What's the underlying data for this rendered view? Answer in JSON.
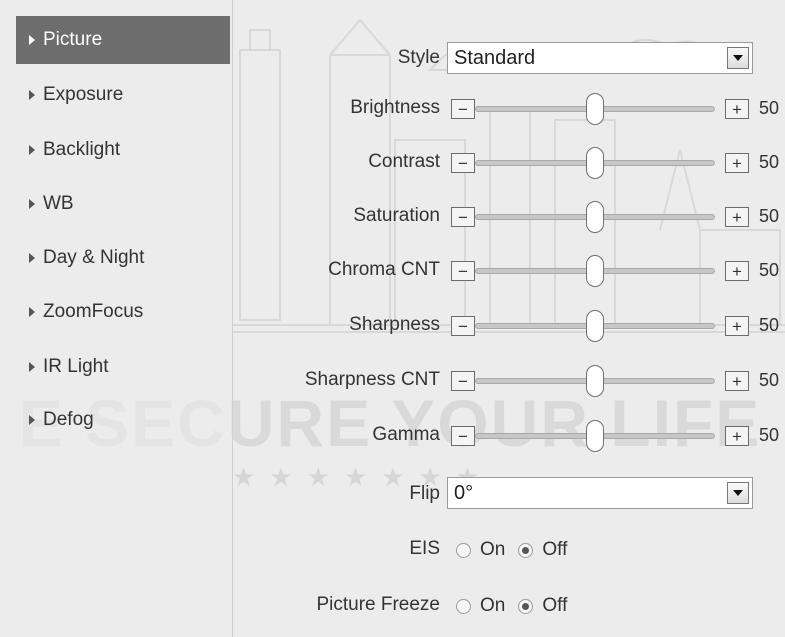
{
  "sidebar": {
    "items": [
      {
        "label": "Picture",
        "active": true
      },
      {
        "label": "Exposure",
        "active": false
      },
      {
        "label": "Backlight",
        "active": false
      },
      {
        "label": "WB",
        "active": false
      },
      {
        "label": "Day & Night",
        "active": false
      },
      {
        "label": "ZoomFocus",
        "active": false
      },
      {
        "label": "IR Light",
        "active": false
      },
      {
        "label": "Defog",
        "active": false
      }
    ]
  },
  "watermark": {
    "text": "E SECURE YOUR LIFE",
    "stars": "★★★★★★★"
  },
  "form": {
    "style": {
      "label": "Style",
      "value": "Standard"
    },
    "sliders": [
      {
        "label": "Brightness",
        "value": "50",
        "level": 50
      },
      {
        "label": "Contrast",
        "value": "50",
        "level": 50
      },
      {
        "label": "Saturation",
        "value": "50",
        "level": 50
      },
      {
        "label": "Chroma CNT",
        "value": "50",
        "level": 50
      },
      {
        "label": "Sharpness",
        "value": "50",
        "level": 50
      },
      {
        "label": "Sharpness CNT",
        "value": "50",
        "level": 50
      },
      {
        "label": "Gamma",
        "value": "50",
        "level": 50
      }
    ],
    "flip": {
      "label": "Flip",
      "value": "0°"
    },
    "eis": {
      "label": "EIS",
      "on_label": "On",
      "off_label": "Off",
      "selected": "Off"
    },
    "picture_freeze": {
      "label": "Picture Freeze",
      "on_label": "On",
      "off_label": "Off",
      "selected": "Off"
    },
    "minus_symbol": "−",
    "plus_symbol": "+"
  },
  "colors": {
    "active_item_bg": "#6d6d6d",
    "background": "#ececec",
    "watermark": "#d9d9d9"
  }
}
